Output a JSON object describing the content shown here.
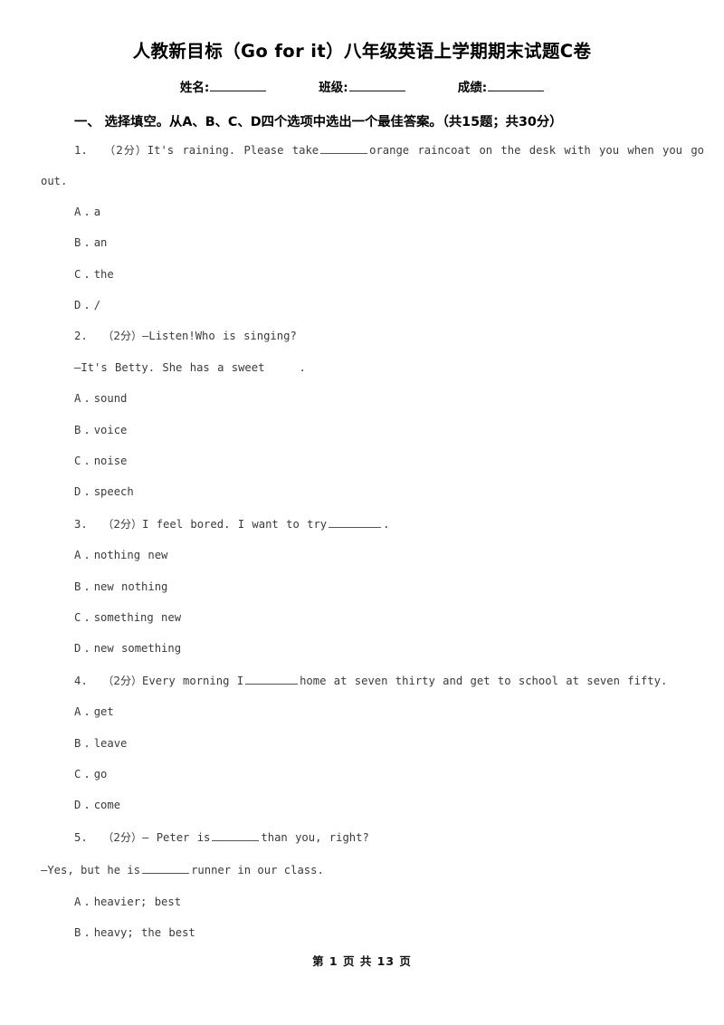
{
  "document": {
    "title": "人教新目标（Go for it）八年级英语上学期期末试题C卷",
    "footer": "第 1 页 共 13 页"
  },
  "identity_fields": [
    {
      "label": "姓名:",
      "value": ""
    },
    {
      "label": "班级:",
      "value": ""
    },
    {
      "label": "成绩:",
      "value": ""
    }
  ],
  "sections": [
    {
      "heading": "一、 选择填空。从A、B、C、D四个选项中选出一个最佳答案。（共15题；共30分）"
    }
  ],
  "questions": [
    {
      "number": "1.",
      "score": "（2分）",
      "stem_part1": "It's raining. Please take",
      "stem_part2": "orange raincoat on the desk with you when you go",
      "stem_wrap": "out.",
      "options": [
        {
          "key": "A",
          "dot": ".",
          "text": "a"
        },
        {
          "key": "B",
          "dot": ".",
          "text": "an"
        },
        {
          "key": "C",
          "dot": ".",
          "text": "the"
        },
        {
          "key": "D",
          "dot": ".",
          "text": "/"
        }
      ]
    },
    {
      "number": "2.",
      "score": "（2分）",
      "stem_part1": "—Listen!Who is singing?",
      "stem_line2": "—It's Betty. She has a sweet",
      "stem_line2_tail": ".",
      "options": [
        {
          "key": "A",
          "dot": ".",
          "text": "sound"
        },
        {
          "key": "B",
          "dot": ".",
          "text": "voice"
        },
        {
          "key": "C",
          "dot": ".",
          "text": "noise"
        },
        {
          "key": "D",
          "dot": ".",
          "text": "speech"
        }
      ]
    },
    {
      "number": "3.",
      "score": "（2分）",
      "stem_part1": "I feel bored. I want to try",
      "stem_part2": ".",
      "options": [
        {
          "key": "A",
          "dot": ".",
          "text": "nothing new"
        },
        {
          "key": "B",
          "dot": ".",
          "text": "new nothing"
        },
        {
          "key": "C",
          "dot": ".",
          "text": "something new"
        },
        {
          "key": "D",
          "dot": ".",
          "text": "new something"
        }
      ]
    },
    {
      "number": "4.",
      "score": "（2分）",
      "stem_part1": "Every morning I",
      "stem_part2": "home at seven thirty and get to school at seven fifty.",
      "options": [
        {
          "key": "A",
          "dot": ".",
          "text": "get"
        },
        {
          "key": "B",
          "dot": ".",
          "text": "leave"
        },
        {
          "key": "C",
          "dot": ".",
          "text": "go"
        },
        {
          "key": "D",
          "dot": ".",
          "text": "come"
        }
      ]
    },
    {
      "number": "5.",
      "score": "（2分）",
      "stem_part1": "— Peter is",
      "stem_part2": "than you, right?",
      "stem_line2_a": "—Yes, but he is",
      "stem_line2_b": "runner in our class.",
      "options": [
        {
          "key": "A",
          "dot": ".",
          "text": "heavier; best"
        },
        {
          "key": "B",
          "dot": ".",
          "text": "heavy; the best"
        }
      ]
    }
  ]
}
